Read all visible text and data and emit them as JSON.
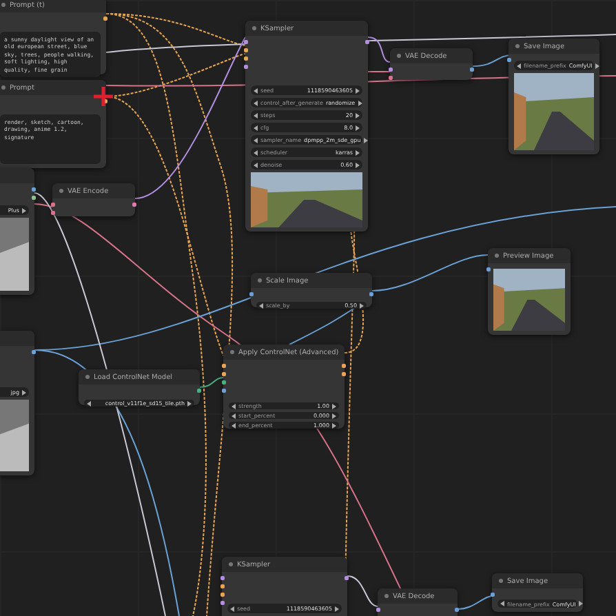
{
  "nodes": [
    {
      "kind": "text",
      "title": "Prompt (t)",
      "text": "a sunny daylight view of an old european street, blue sky, trees, people walking, soft lighting, high quality, fine grain"
    },
    {
      "kind": "image",
      "title": "KSampler",
      "widgets": [
        {
          "label": "seed",
          "value": "1118590463605"
        },
        {
          "label": "control_after_generate",
          "value": "randomize"
        },
        {
          "label": "steps",
          "value": "20"
        },
        {
          "label": "cfg",
          "value": "8.0"
        },
        {
          "label": "sampler_name",
          "value": "dpmpp_2m_sde_gpu"
        },
        {
          "label": "scheduler",
          "value": "karras"
        },
        {
          "label": "denoise",
          "value": "0.60"
        }
      ]
    },
    {
      "kind": "plain",
      "title": "VAE Decode"
    },
    {
      "kind": "image",
      "title": "Save Image",
      "widgets": [
        {
          "label": "filename_prefix",
          "value": "ComfyUI"
        }
      ]
    },
    {
      "kind": "text",
      "title": "Prompt",
      "text": "render, sketch, cartoon, drawing, anime 1.2, signature"
    },
    {
      "kind": "image",
      "widgets": [
        {
          "value": "Plus"
        }
      ]
    },
    {
      "kind": "plain",
      "title": "VAE Encode"
    },
    {
      "kind": "image",
      "title": "Preview Image"
    },
    {
      "kind": "widgets",
      "title": "Scale Image",
      "widgets": [
        {
          "label": "scale_by",
          "value": "0.50"
        }
      ]
    },
    {
      "kind": "image",
      "widgets": [
        {
          "value": "jpg"
        }
      ]
    },
    {
      "kind": "widgets",
      "title": "Load ControlNet Model",
      "widgets": [
        {
          "value": "control_v11f1e_sd15_tile.pth"
        }
      ]
    },
    {
      "kind": "widgets",
      "title": "Apply ControlNet (Advanced)",
      "widgets": [
        {
          "label": "strength",
          "value": "1.00"
        },
        {
          "label": "start_percent",
          "value": "0.000"
        },
        {
          "label": "end_percent",
          "value": "1.000"
        }
      ]
    },
    {
      "kind": "widgets",
      "title": "KSampler",
      "widgets": [
        {
          "label": "seed",
          "value": "1118590463605"
        }
      ]
    },
    {
      "kind": "widgets",
      "title": "Save Image",
      "widgets": [
        {
          "label": "filename_prefix",
          "value": "ComfyUI"
        }
      ]
    },
    {
      "kind": "plain",
      "title": "VAE Decode"
    }
  ]
}
